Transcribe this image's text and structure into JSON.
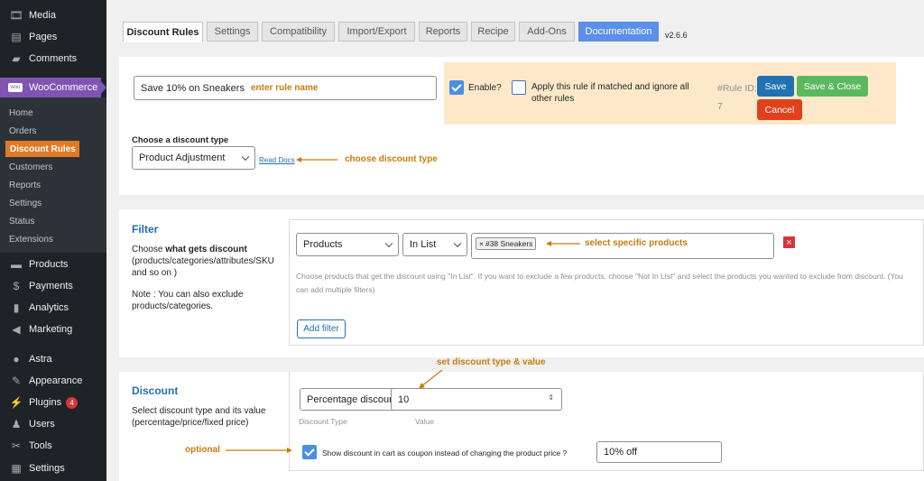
{
  "sidebar": {
    "top_items": [
      {
        "label": "Media",
        "icon": "media-icon"
      },
      {
        "label": "Pages",
        "icon": "pages-icon"
      },
      {
        "label": "Comments",
        "icon": "comments-icon"
      }
    ],
    "woocommerce": {
      "label": "WooCommerce",
      "icon": "woo-icon",
      "icon_text": "woo"
    },
    "sub_items": [
      {
        "label": "Home"
      },
      {
        "label": "Orders"
      },
      {
        "label": "Discount Rules"
      },
      {
        "label": "Customers"
      },
      {
        "label": "Reports"
      },
      {
        "label": "Settings"
      },
      {
        "label": "Status"
      },
      {
        "label": "Extensions"
      }
    ],
    "bottom_items": [
      {
        "label": "Products",
        "icon": "products-icon"
      },
      {
        "label": "Payments",
        "icon": "payments-icon"
      },
      {
        "label": "Analytics",
        "icon": "analytics-icon"
      },
      {
        "label": "Marketing",
        "icon": "marketing-icon"
      },
      {
        "label": "Astra",
        "icon": "astra-icon"
      },
      {
        "label": "Appearance",
        "icon": "appearance-icon"
      },
      {
        "label": "Plugins",
        "icon": "plugins-icon",
        "badge": "4"
      },
      {
        "label": "Users",
        "icon": "users-icon"
      },
      {
        "label": "Tools",
        "icon": "tools-icon"
      },
      {
        "label": "Settings",
        "icon": "settings-icon"
      }
    ]
  },
  "tabs": [
    "Discount Rules",
    "Settings",
    "Compatibility",
    "Import/Export",
    "Reports",
    "Recipe",
    "Add-Ons",
    "Documentation"
  ],
  "version": "v2.6.6",
  "rule": {
    "name_value": "Save 10% on Sneakers",
    "name_annotation": "enter rule name",
    "enable_label": "Enable?",
    "apply_label": "Apply this rule if matched and ignore all other rules",
    "rule_id_label": "#Rule ID:",
    "rule_id_value": "7",
    "save": "Save",
    "save_close": "Save & Close",
    "cancel": "Cancel",
    "discount_type_label": "Choose a discount type",
    "discount_type_value": "Product Adjustment",
    "read_docs": "Read Docs",
    "discount_type_annotation": "choose discount type"
  },
  "filter": {
    "heading": "Filter",
    "desc_pre": "Choose ",
    "desc_bold": "what gets discount",
    "desc_post": "(products/categories/attributes/SKU and so on )",
    "note": "Note : You can also exclude products/categories.",
    "type_value": "Products",
    "method_value": "In List",
    "tag_remove": "×",
    "tag_value": "#38 Sneakers",
    "annotation": "select specific products",
    "remove_icon": "×",
    "help": "Choose products that get the discount using \"In List\". If you want to exclude a few products, choose \"Not In List\" and select the products you wanted to exclude from discount. (You can add multiple filters)",
    "add_filter": "Add filter"
  },
  "discount": {
    "heading": "Discount",
    "desc": "Select discount type and its value (percentage/price/fixed price)",
    "type_value": "Percentage discount",
    "type_label": "Discount Type",
    "value": "10",
    "value_label": "Value",
    "annotation": "set discount type & value",
    "optional": "optional",
    "coupon_label": "Show discount in cart as coupon instead of changing the product price ?",
    "coupon_value": "10% off"
  },
  "colors": {
    "annotation": "#c77c0d",
    "woo_purple": "#7f54b3",
    "active_sub": "#e07a25",
    "save_blue": "#2271b1",
    "save_close_green": "#5cb85c",
    "cancel_red": "#e2401c",
    "doc_tab": "#5b8fe8",
    "rule_bg": "#fde9c9"
  }
}
